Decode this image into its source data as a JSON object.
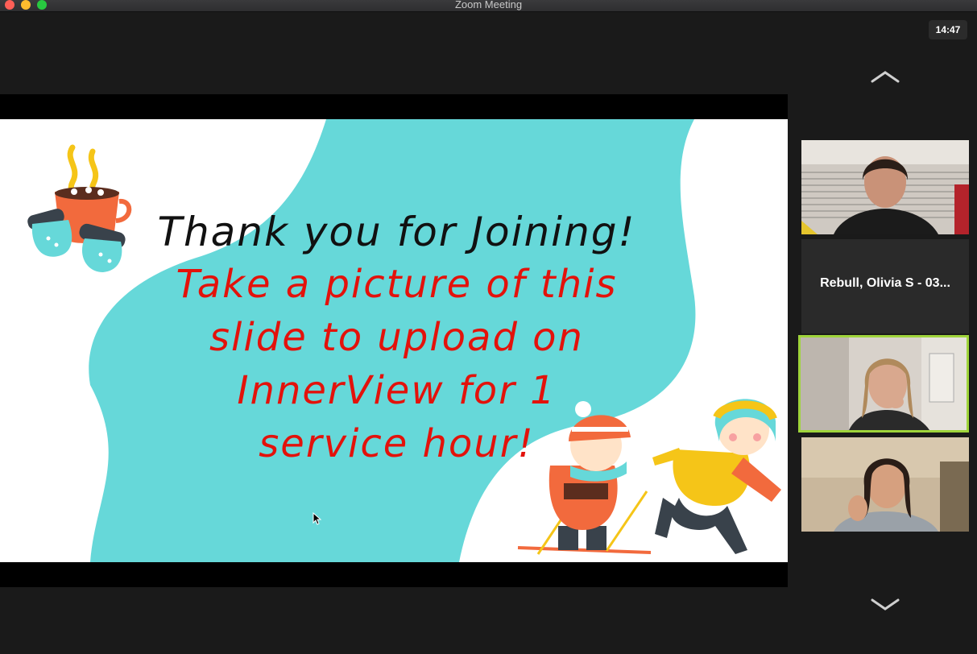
{
  "window": {
    "title": "Zoom Meeting",
    "traffic_lights": [
      "close",
      "minimize",
      "zoom"
    ]
  },
  "clock": "14:47",
  "slide": {
    "heading": "Thank you for Joining!",
    "body_lines": [
      "Take a picture of this",
      "slide to upload on",
      "InnerView for 1",
      "service hour!"
    ],
    "colors": {
      "heading": "#111111",
      "body": "#e3120b",
      "blob": "#66d8d9",
      "background": "#ffffff"
    },
    "decorations": [
      "hot-cocoa-mittens-illustration",
      "children-skiing-skating-illustration"
    ]
  },
  "participants": [
    {
      "type": "video",
      "icon": "participant-video-1"
    },
    {
      "type": "name",
      "name": "Rebull, Olivia S - 03..."
    },
    {
      "type": "video",
      "icon": "participant-video-2",
      "active_speaker": true
    },
    {
      "type": "video",
      "icon": "participant-video-3"
    }
  ],
  "gallery_nav": {
    "up": "chevron-up-icon",
    "down": "chevron-down-icon"
  },
  "accent_color": "#9fd43b"
}
